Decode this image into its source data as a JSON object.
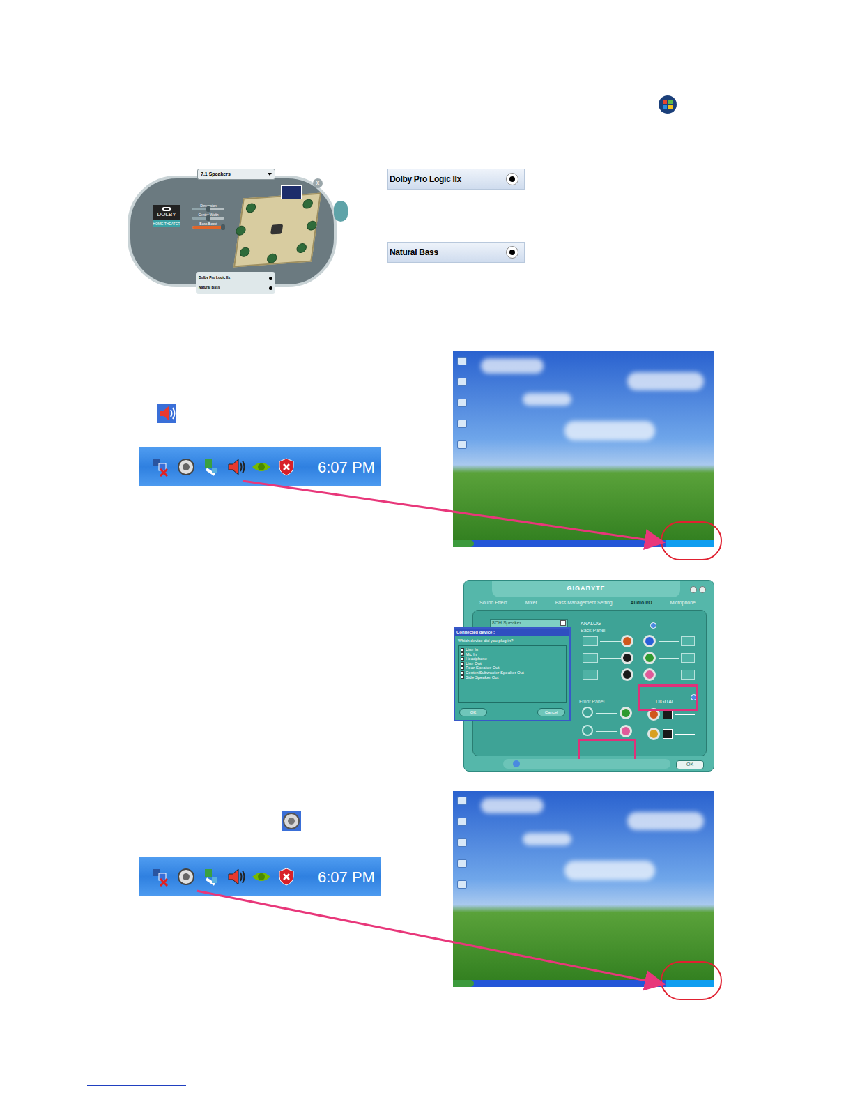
{
  "dolby_panel": {
    "speaker_config": "7.1 Speakers",
    "logo": "DOLBY",
    "logo_sub": "HOME THEATER",
    "close": "x",
    "sliders": [
      {
        "label": "Dimension",
        "level": 0.5
      },
      {
        "label": "Center Width",
        "level": 0.5
      },
      {
        "label": "Bass Boost",
        "level": 0.95
      }
    ],
    "toggles": [
      {
        "label": "Dolby Pro Logic IIx",
        "on": true
      },
      {
        "label": "Natural Bass",
        "on": true
      }
    ]
  },
  "callouts": [
    {
      "label": "Dolby Pro Logic IIx",
      "on": true
    },
    {
      "label": "Natural Bass",
      "on": true
    }
  ],
  "taskbars": [
    {
      "clock": "6:07 PM"
    },
    {
      "clock": "6:07 PM"
    }
  ],
  "audio_manager": {
    "brand": "GIGABYTE",
    "tabs": [
      {
        "label": "Sound Effect",
        "selected": false
      },
      {
        "label": "Mixer",
        "selected": false
      },
      {
        "label": "Bass Management Setting",
        "selected": false
      },
      {
        "label": "Audio I/O",
        "selected": true
      },
      {
        "label": "Microphone",
        "selected": false
      }
    ],
    "device": "8CH Speaker",
    "sections": {
      "analog": "ANALOG",
      "back_panel": "Back Panel",
      "front_panel": "Front Panel",
      "digital": "DIGITAL"
    },
    "back_left_jacks": [
      {
        "color": "#d0581c"
      },
      {
        "color": "#1a1a1a"
      },
      {
        "color": "#1a1a1a"
      }
    ],
    "back_right_jacks": [
      {
        "color": "#2a5fd8"
      },
      {
        "color": "#2f9a2f"
      },
      {
        "color": "#e05a9a"
      }
    ],
    "front_jacks": [
      {
        "color": "#2f9a2f"
      },
      {
        "color": "#e05a9a"
      }
    ],
    "digital_jacks": [
      {
        "color": "#d0581c"
      },
      {
        "color": "#d8a020"
      }
    ],
    "ok": "OK",
    "dialog": {
      "title": "Connected device :",
      "question": "Which device did you plug in?",
      "options": [
        {
          "label": "Line In",
          "checked": false
        },
        {
          "label": "Mic In",
          "checked": true
        },
        {
          "label": "Headphone",
          "checked": false
        },
        {
          "label": "Line Out",
          "checked": false
        },
        {
          "label": "Rear Speaker Out",
          "checked": false
        },
        {
          "label": "Center/Subwoofer Speaker Out",
          "checked": false
        },
        {
          "label": "Side Speaker Out",
          "checked": false
        }
      ],
      "buttons": [
        "OK",
        "Cancel"
      ]
    }
  }
}
